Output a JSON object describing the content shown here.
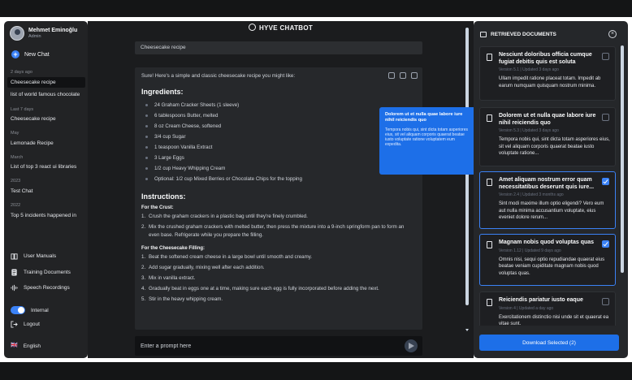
{
  "sidebar": {
    "user": {
      "name": "Mehmet Eminoğlu",
      "role": "Admin"
    },
    "new_chat": "New Chat",
    "history": [
      {
        "group": "2 days ago",
        "items": [
          "Cheesecake recipe",
          "list of world famous chocolate"
        ]
      },
      {
        "group": "Last 7 days",
        "items": [
          "Cheesecake recipe"
        ]
      },
      {
        "group": "May",
        "items": [
          "Lemonade Recipe"
        ]
      },
      {
        "group": "March",
        "items": [
          "List of top 3 react ui libraries"
        ]
      },
      {
        "group": "2023",
        "items": [
          "Test Chat"
        ]
      },
      {
        "group": "2022",
        "items": [
          "Top 5 incidents happened in"
        ]
      }
    ],
    "nav": [
      "User Manuals",
      "Training Documents",
      "Speech Recordings"
    ],
    "toggle_label": "Internal",
    "logout": "Logout",
    "language": "English",
    "flag": "🇬🇧"
  },
  "main": {
    "title": "HYVE CHATBOT",
    "user_message": "Cheesecake recipe",
    "answer": {
      "intro": "Sure! Here's a simple and classic cheesecake recipe you might like:",
      "ingredients_title": "Ingredients:",
      "ingredients": [
        "24 Graham Cracker Sheets (1 sleeve)",
        "6 tablespoons Butter, melted",
        "8 oz Cream Cheese, softened",
        "3/4 cup Sugar",
        "1 teaspoon Vanilla Extract",
        "3 Large Eggs",
        "1/2 cup Heavy Whipping Cream",
        "Optional: 1/2 cup Mixed Berries or Chocolate Chips for the topping"
      ],
      "instructions_title": "Instructions:",
      "crust_title": "For the Crust:",
      "crust_steps": [
        "Crush the graham crackers in a plastic bag until they're finely crumbled.",
        "Mix the crushed graham crackers with melted butter, then press the mixture into a 9-inch springform pan to form an even base. Refrigerate while you prepare the filling."
      ],
      "filling_title": "For the Cheesecake Filling:",
      "filling_steps": [
        "Beat the softened cream cheese in a large bowl until smooth and creamy.",
        "Add sugar gradually, mixing well after each addition.",
        "Mix in vanilla extract.",
        "Gradually beat in eggs one at a time, making sure each egg is fully incorporated before adding the next.",
        "Stir in the heavy whipping cream."
      ]
    },
    "prompt_placeholder": "Enter a prompt here"
  },
  "tooltip": {
    "title": "Dolorem ut et nulla quae labore iure nihil reiciendis quo",
    "body": "Tempora nobis qui, sint dicta totam asperiores eius, sit vel aliquam corporis quaerat beatae iusto voluptate ratione voluptatem eum expedita."
  },
  "panel": {
    "title": "RETRIEVED DOCUMENTS",
    "documents": [
      {
        "title": "Nesciunt doloribus officia cumque fugiat debitis quis est soluta",
        "meta": "Version 5.1 | Updated 3 days ago",
        "body": "Ullam impedit ratione placeat totam. Impedit ab earum numquam quisquam nostrum minima.",
        "selected": false
      },
      {
        "title": "Dolorem ut et nulla quae labore iure nihil reiciendis quo",
        "meta": "Version 5.3 | Updated 3 days ago",
        "body": "Tempora nobis qui, sint dicta totam asperiores eius, sit vel aliquam corporis quaerat beatae iusto voluptate ratione...",
        "selected": false
      },
      {
        "title": "Amet aliquam nostrum error quam necessitatibus deserunt quis iure...",
        "meta": "Version 2.4 | Updated 3 months ago",
        "body": "Sint modi maxime illum optio eligendi? Vero eum aut nulla minima accusantium voluptate, eius eveniet dolore rerum...",
        "selected": true
      },
      {
        "title": "Magnam nobis quod voluptas quas",
        "meta": "Version 1.12 | Updated 9 days ago",
        "body": "Omnis nisi, sequi optio repudiandae quaerat eius beatae veniam cupiditate magnam nobis quod voluptas quas.",
        "selected": true
      },
      {
        "title": "Reiciendis pariatur iusto eaque",
        "meta": "Version 4 | Updated a day ago",
        "body": "Exercitationem distinctio nisi unde sit et quaerat ea vitae sunt.",
        "selected": false
      }
    ],
    "download_label": "Download Selected (2)"
  },
  "colors": {
    "accent": "#1d6fe8",
    "sidebar_bg": "#222325",
    "main_bg": "#1b1c1e",
    "panel_bg": "#25272a"
  }
}
